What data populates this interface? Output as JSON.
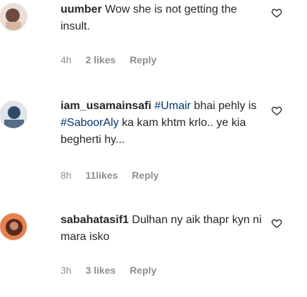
{
  "comments": [
    {
      "username": "uumber",
      "segments": [
        {
          "text": "Wow she is not getting the insult.",
          "type": "text"
        }
      ],
      "time": "4h",
      "likes": "2 likes",
      "reply": "Reply",
      "avatar_colors": [
        "#6d4a3b",
        "#d9b5a0"
      ]
    },
    {
      "username": "iam_usamainsafi",
      "segments": [
        {
          "text": "#Umair",
          "type": "mention"
        },
        {
          "text": " bhai pehly is ",
          "type": "text"
        },
        {
          "text": "#SaboorAly",
          "type": "mention"
        },
        {
          "text": " ka kam khtm krlo.. ye kia begherti hy...",
          "type": "text"
        }
      ],
      "time": "8h",
      "likes": "11likes",
      "reply": "Reply",
      "avatar_colors": [
        "#2f4a6a",
        "#c8ccd4"
      ]
    },
    {
      "username": "sabahatasif1",
      "segments": [
        {
          "text": "Dulhan ny aik thapr kyn ni mara isko",
          "type": "text"
        }
      ],
      "time": "3h",
      "likes": "3 likes",
      "reply": "Reply",
      "avatar_colors": [
        "#e87f4e",
        "#5b2a1d"
      ]
    }
  ]
}
